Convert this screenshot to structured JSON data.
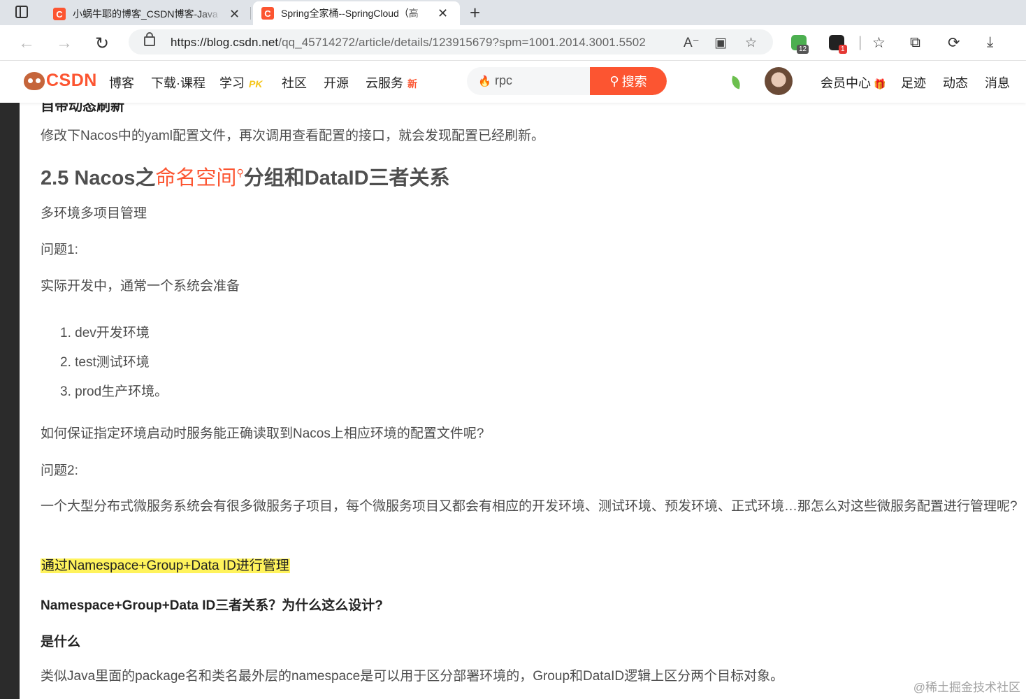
{
  "browser": {
    "tabs": [
      {
        "title": "小蜗牛耶的博客_CSDN博客-Java",
        "close": "✕"
      },
      {
        "title": "Spring全家桶--SpringCloud（高",
        "close": "✕"
      }
    ],
    "new_tab": "+",
    "url_host": "https://blog.csdn.net",
    "url_path": "/qq_45714272/article/details/123915679?spm=1001.2014.3001.5502",
    "ext_badges": [
      "12",
      "1"
    ]
  },
  "csdn": {
    "logo": "CSDN",
    "nav": [
      "博客",
      "下载·课程",
      "学习",
      "社区",
      "开源",
      "云服务"
    ],
    "tag_pk": "PK",
    "tag_new": "新",
    "search_value": "rpc",
    "search_button": "搜索",
    "right_nav": [
      "会员中心",
      "足迹",
      "动态",
      "消息"
    ]
  },
  "article": {
    "cutoff_heading": "自带动态刷新",
    "p_refresh": "修改下Nacos中的yaml配置文件，再次调用查看配置的接口，就会发现配置已经刷新。",
    "h2_prefix": "2.5 Nacos之",
    "h2_keyword": "命名空间",
    "h2_suffix": "分组和DataID三者关系",
    "p_multi": "多环境多项目管理",
    "q1": "问题1:",
    "q1_text": "实际开发中，通常一个系统会准备",
    "list": [
      "1. dev开发环境",
      "2. test测试环境",
      "3. prod生产环境。"
    ],
    "q1_question": "如何保证指定环境启动时服务能正确读取到Nacos上相应环境的配置文件呢?",
    "q2": "问题2:",
    "q2_text": "一个大型分布式微服务系统会有很多微服务子项目，每个微服务项目又都会有相应的开发环境、测试环境、预发环境、正式环境…那怎么对这些微服务配置进行管理呢?",
    "highlight": "通过Namespace+Group+Data ID进行管理",
    "bold_q": "Namespace+Group+Data ID三者关系？为什么这么设计?",
    "what": "是什么",
    "last": "类似Java里面的package名和类名最外层的namespace是可以用于区分部署环境的，Group和DataID逻辑上区分两个目标对象。"
  },
  "watermark": "@稀土掘金技术社区"
}
